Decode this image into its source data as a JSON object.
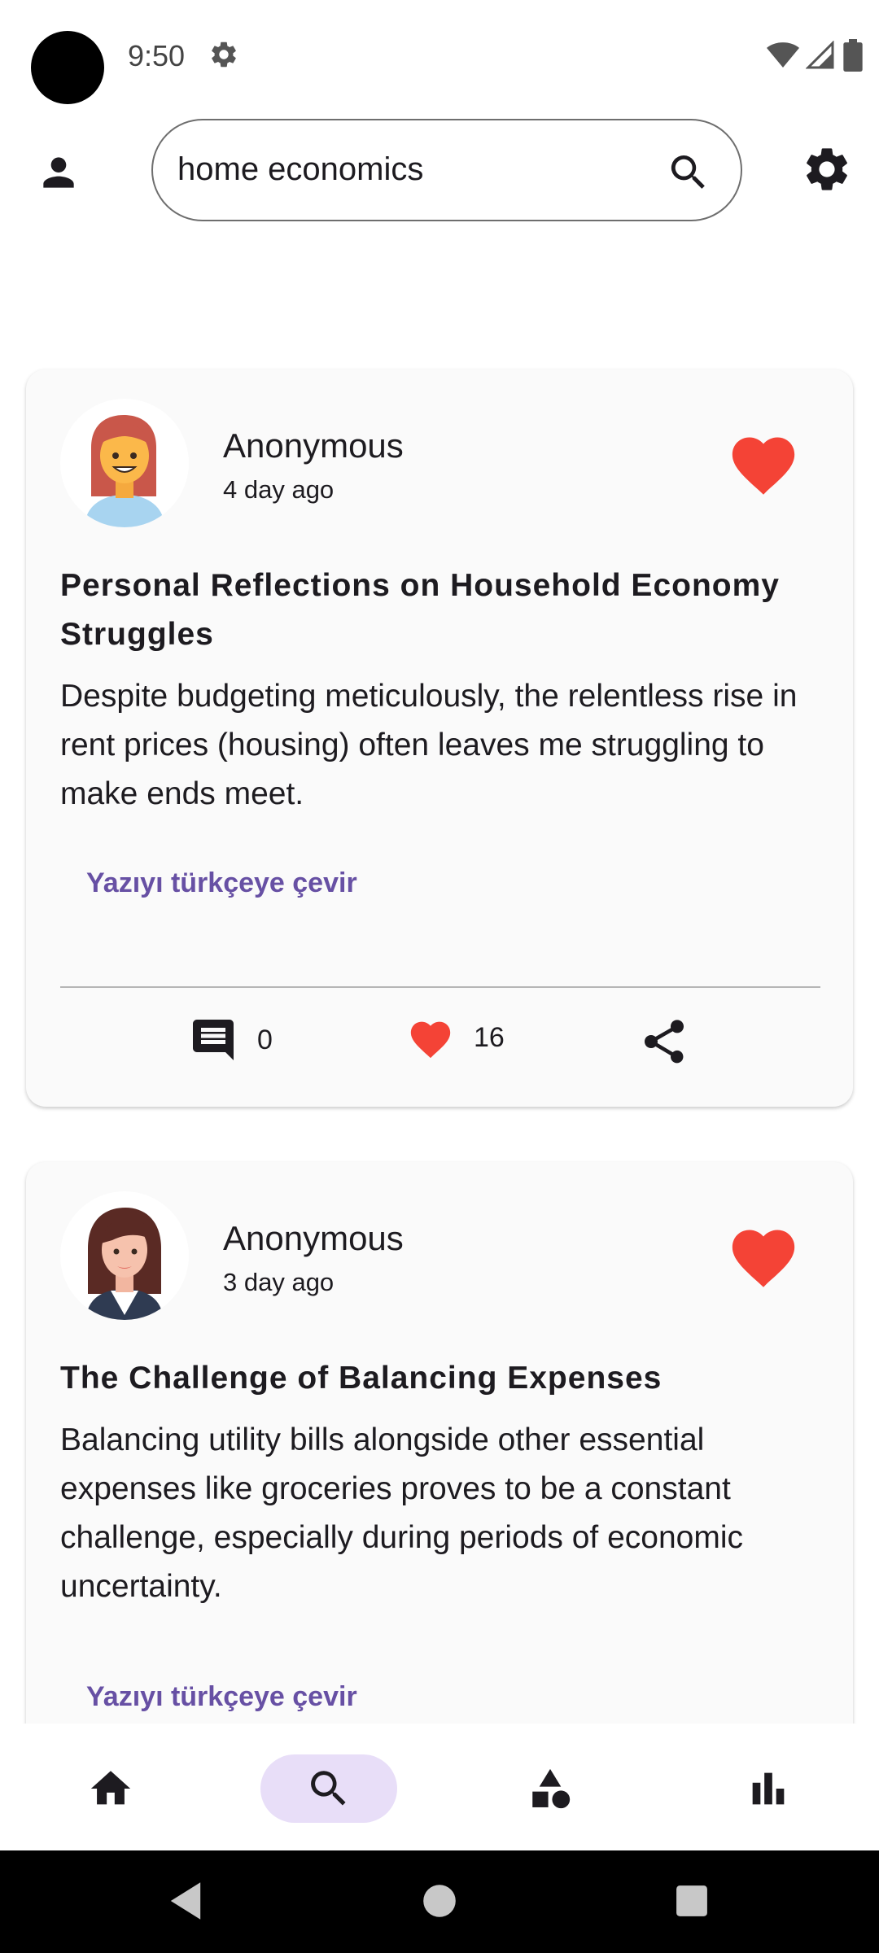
{
  "status_bar": {
    "time": "9:50"
  },
  "header": {
    "search_value": "home economics"
  },
  "posts": [
    {
      "author": "Anonymous",
      "time_ago": "4 day ago",
      "title": "Personal Reflections on Household Economy Struggles",
      "body": "Despite budgeting meticulously, the relentless rise in rent prices (housing) often leaves me struggling to make ends meet.",
      "translate_label": "Yazıyı türkçeye çevir",
      "comments": "0",
      "likes": "16"
    },
    {
      "author": "Anonymous",
      "time_ago": "3 day ago",
      "title": "The Challenge of Balancing Expenses",
      "body": "Balancing utility bills alongside other essential expenses like groceries proves to be a constant challenge, especially during periods of economic uncertainty.",
      "translate_label": "Yazıyı türkçeye çevir"
    }
  ],
  "bottom_nav": [
    "home-icon",
    "search-icon",
    "shapes-icon",
    "bar-chart-icon"
  ],
  "colors": {
    "accent": "#6750a4",
    "heart": "#f44336",
    "nav_active": "#e8def8"
  }
}
